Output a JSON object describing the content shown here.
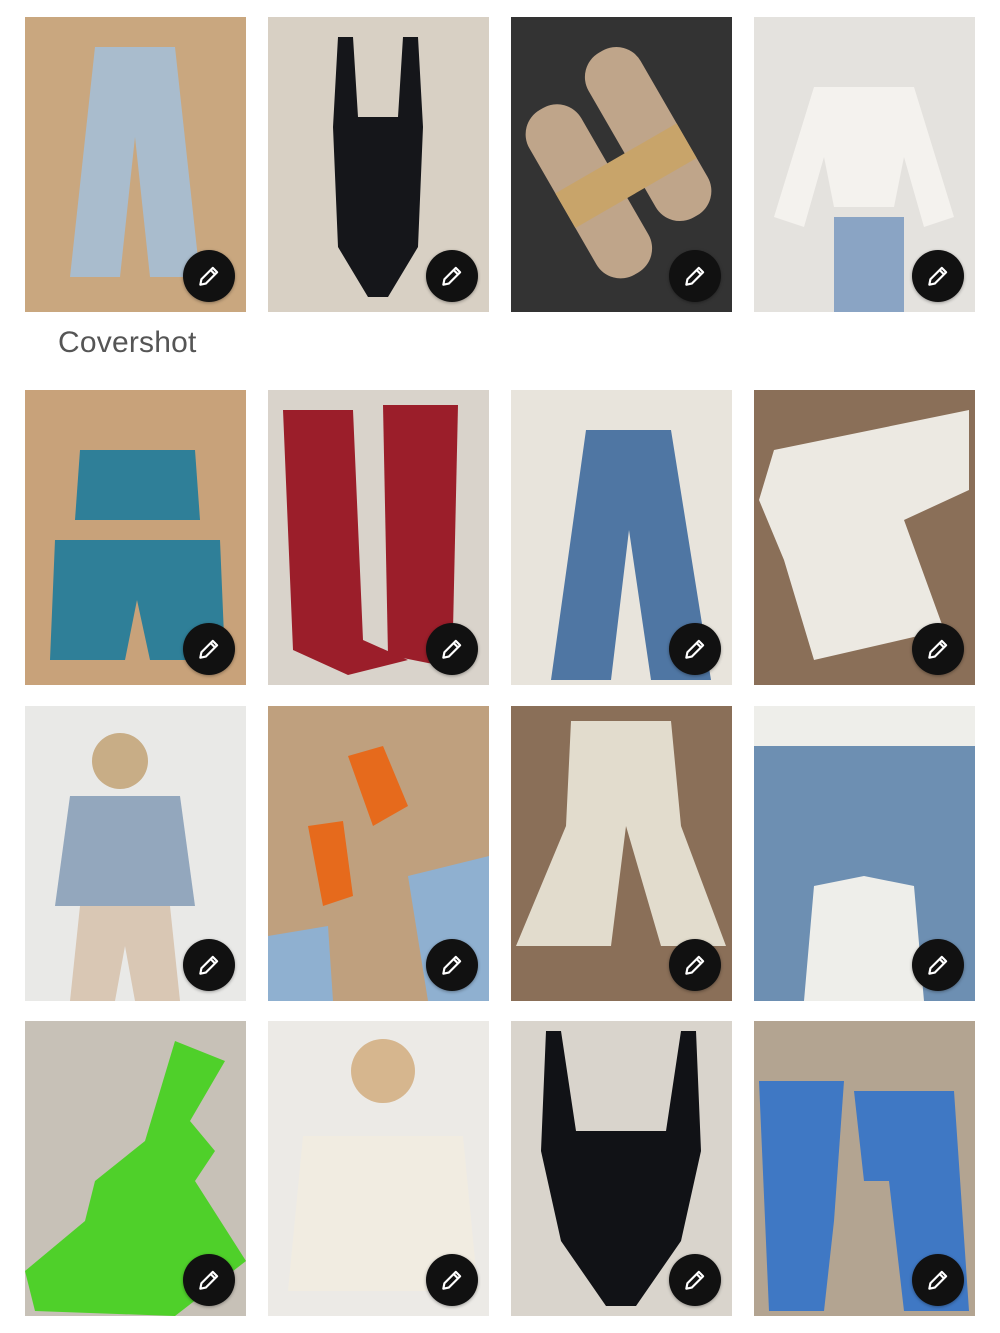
{
  "section": {
    "label": "Covershot"
  },
  "edit_icon": "pencil-icon",
  "tiles": [
    {
      "name": "wide-leg-jeans",
      "bg": "#c9a77f",
      "fg": "#a9bccd"
    },
    {
      "name": "black-bodysuit",
      "bg": "#d8d0c4",
      "fg": "#15161a"
    },
    {
      "name": "raffia-slide-sandals",
      "bg": "#333333",
      "fg": "#bfa58a"
    },
    {
      "name": "white-eyelet-tie-top",
      "bg": "#e4e2de",
      "fg": "#f4f2ee"
    },
    {
      "name": "crochet-top-shorts-set",
      "bg": "#c8a27a",
      "fg": "#2f7f98"
    },
    {
      "name": "red-studded-cowboy-boots",
      "bg": "#d9d3cb",
      "fg": "#9b1e2a"
    },
    {
      "name": "patchwork-flare-jeans",
      "bg": "#e8e4dc",
      "fg": "#4f76a3"
    },
    {
      "name": "lace-bell-sleeve-dress",
      "bg": "#8a6f58",
      "fg": "#ece9e2"
    },
    {
      "name": "denim-jacket-zebra-pants",
      "bg": "#e9e9e7",
      "fg": "#93a7bd"
    },
    {
      "name": "orange-jelly-sandals",
      "bg": "#bfa07e",
      "fg": "#e66a1c"
    },
    {
      "name": "crochet-flare-pants",
      "bg": "#8a6f58",
      "fg": "#e2dccd"
    },
    {
      "name": "fringe-denim-jacket",
      "bg": "#eeeeea",
      "fg": "#6d8fb2"
    },
    {
      "name": "green-crochet-halter-dress",
      "bg": "#c7c1b7",
      "fg": "#4fd02a"
    },
    {
      "name": "white-lace-off-shoulder-top",
      "bg": "#eceae6",
      "fg": "#f1ece1"
    },
    {
      "name": "black-corset-bodysuit",
      "bg": "#d9d4cc",
      "fg": "#111216"
    },
    {
      "name": "patchwork-denim-jeans",
      "bg": "#b3a491",
      "fg": "#3f78c4"
    }
  ]
}
